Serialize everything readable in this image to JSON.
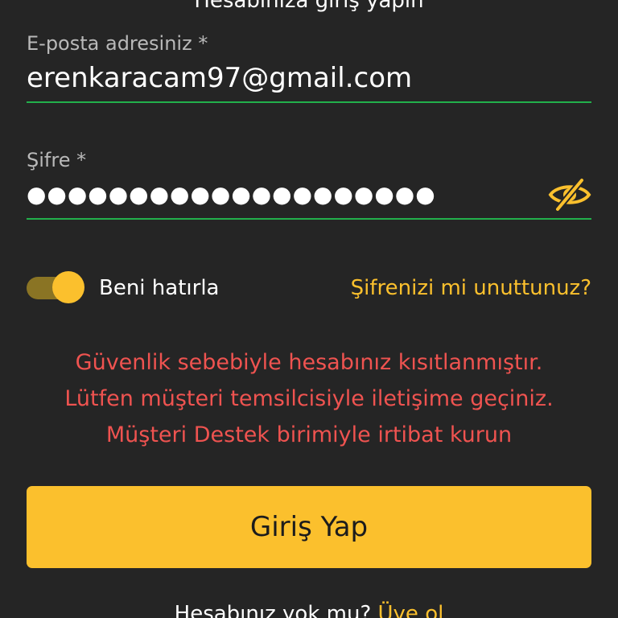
{
  "page": {
    "heading": "Hesabınıza giriş yapın"
  },
  "email": {
    "label": "E-posta adresiniz *",
    "value": "erenkaracam97@gmail.com"
  },
  "password": {
    "label": "Şifre *",
    "value": "●●●●●●●●●●●●●●●●●●●●",
    "visibility_icon": "eye-slash-icon"
  },
  "remember": {
    "label": "Beni hatırla",
    "enabled": true
  },
  "forgot_link": "Şifrenizi mi unuttunuz?",
  "error": {
    "lines": [
      "Güvenlik sebebiyle hesabınız kısıtlanmıştır.",
      "Lütfen müşteri temsilcisiyle iletişime geçiniz.",
      "Müşteri Destek birimiyle irtibat kurun"
    ]
  },
  "login_button": {
    "label": "Giriş Yap"
  },
  "signup": {
    "text": "Hesabınız yok mu?",
    "link": "Üye ol"
  },
  "colors": {
    "background": "#252525",
    "accent": "#fbc02d",
    "input_underline": "#22b04b",
    "error": "#ef5350",
    "label": "#b9b9b9"
  }
}
